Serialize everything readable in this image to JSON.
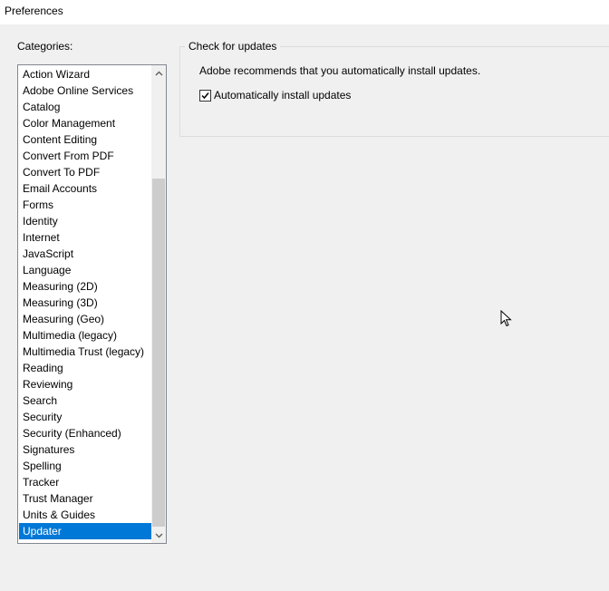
{
  "window": {
    "title": "Preferences"
  },
  "categories": {
    "label": "Categories:",
    "items": [
      "Action Wizard",
      "Adobe Online Services",
      "Catalog",
      "Color Management",
      "Content Editing",
      "Convert From PDF",
      "Convert To PDF",
      "Email Accounts",
      "Forms",
      "Identity",
      "Internet",
      "JavaScript",
      "Language",
      "Measuring (2D)",
      "Measuring (3D)",
      "Measuring (Geo)",
      "Multimedia (legacy)",
      "Multimedia Trust (legacy)",
      "Reading",
      "Reviewing",
      "Search",
      "Security",
      "Security (Enhanced)",
      "Signatures",
      "Spelling",
      "Tracker",
      "Trust Manager",
      "Units & Guides",
      "Updater"
    ],
    "selected": "Updater"
  },
  "updater": {
    "group_title": "Check for updates",
    "recommendation": "Adobe recommends that you automatically install updates.",
    "auto_install_label": "Automatically install updates",
    "auto_install_checked": true
  },
  "colors": {
    "selection": "#0078d7",
    "background": "#f0f0f0"
  },
  "icons": {
    "scroll_up": "chevron-up-icon",
    "scroll_down": "chevron-down-icon",
    "checkmark": "check-icon",
    "cursor": "mouse-pointer-icon"
  }
}
